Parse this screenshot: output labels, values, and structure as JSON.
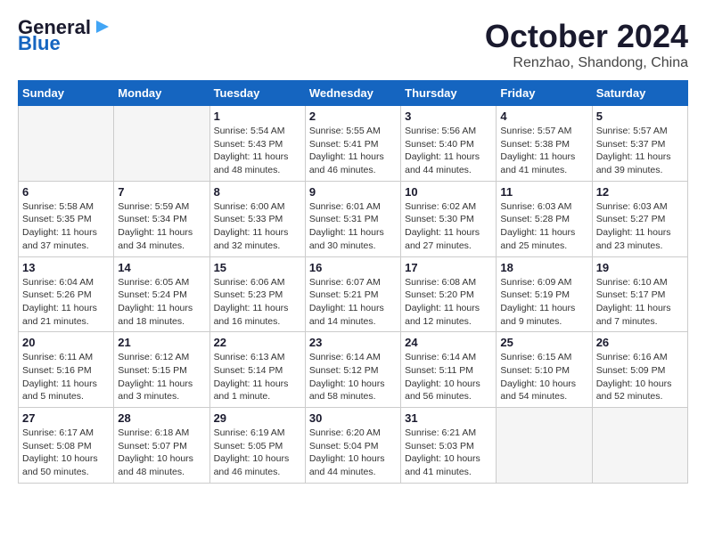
{
  "header": {
    "logo_line1": "General",
    "logo_line2": "Blue",
    "month": "October 2024",
    "location": "Renzhao, Shandong, China"
  },
  "days_of_week": [
    "Sunday",
    "Monday",
    "Tuesday",
    "Wednesday",
    "Thursday",
    "Friday",
    "Saturday"
  ],
  "weeks": [
    [
      {
        "day": "",
        "info": ""
      },
      {
        "day": "",
        "info": ""
      },
      {
        "day": "1",
        "info": "Sunrise: 5:54 AM\nSunset: 5:43 PM\nDaylight: 11 hours and 48 minutes."
      },
      {
        "day": "2",
        "info": "Sunrise: 5:55 AM\nSunset: 5:41 PM\nDaylight: 11 hours and 46 minutes."
      },
      {
        "day": "3",
        "info": "Sunrise: 5:56 AM\nSunset: 5:40 PM\nDaylight: 11 hours and 44 minutes."
      },
      {
        "day": "4",
        "info": "Sunrise: 5:57 AM\nSunset: 5:38 PM\nDaylight: 11 hours and 41 minutes."
      },
      {
        "day": "5",
        "info": "Sunrise: 5:57 AM\nSunset: 5:37 PM\nDaylight: 11 hours and 39 minutes."
      }
    ],
    [
      {
        "day": "6",
        "info": "Sunrise: 5:58 AM\nSunset: 5:35 PM\nDaylight: 11 hours and 37 minutes."
      },
      {
        "day": "7",
        "info": "Sunrise: 5:59 AM\nSunset: 5:34 PM\nDaylight: 11 hours and 34 minutes."
      },
      {
        "day": "8",
        "info": "Sunrise: 6:00 AM\nSunset: 5:33 PM\nDaylight: 11 hours and 32 minutes."
      },
      {
        "day": "9",
        "info": "Sunrise: 6:01 AM\nSunset: 5:31 PM\nDaylight: 11 hours and 30 minutes."
      },
      {
        "day": "10",
        "info": "Sunrise: 6:02 AM\nSunset: 5:30 PM\nDaylight: 11 hours and 27 minutes."
      },
      {
        "day": "11",
        "info": "Sunrise: 6:03 AM\nSunset: 5:28 PM\nDaylight: 11 hours and 25 minutes."
      },
      {
        "day": "12",
        "info": "Sunrise: 6:03 AM\nSunset: 5:27 PM\nDaylight: 11 hours and 23 minutes."
      }
    ],
    [
      {
        "day": "13",
        "info": "Sunrise: 6:04 AM\nSunset: 5:26 PM\nDaylight: 11 hours and 21 minutes."
      },
      {
        "day": "14",
        "info": "Sunrise: 6:05 AM\nSunset: 5:24 PM\nDaylight: 11 hours and 18 minutes."
      },
      {
        "day": "15",
        "info": "Sunrise: 6:06 AM\nSunset: 5:23 PM\nDaylight: 11 hours and 16 minutes."
      },
      {
        "day": "16",
        "info": "Sunrise: 6:07 AM\nSunset: 5:21 PM\nDaylight: 11 hours and 14 minutes."
      },
      {
        "day": "17",
        "info": "Sunrise: 6:08 AM\nSunset: 5:20 PM\nDaylight: 11 hours and 12 minutes."
      },
      {
        "day": "18",
        "info": "Sunrise: 6:09 AM\nSunset: 5:19 PM\nDaylight: 11 hours and 9 minutes."
      },
      {
        "day": "19",
        "info": "Sunrise: 6:10 AM\nSunset: 5:17 PM\nDaylight: 11 hours and 7 minutes."
      }
    ],
    [
      {
        "day": "20",
        "info": "Sunrise: 6:11 AM\nSunset: 5:16 PM\nDaylight: 11 hours and 5 minutes."
      },
      {
        "day": "21",
        "info": "Sunrise: 6:12 AM\nSunset: 5:15 PM\nDaylight: 11 hours and 3 minutes."
      },
      {
        "day": "22",
        "info": "Sunrise: 6:13 AM\nSunset: 5:14 PM\nDaylight: 11 hours and 1 minute."
      },
      {
        "day": "23",
        "info": "Sunrise: 6:14 AM\nSunset: 5:12 PM\nDaylight: 10 hours and 58 minutes."
      },
      {
        "day": "24",
        "info": "Sunrise: 6:14 AM\nSunset: 5:11 PM\nDaylight: 10 hours and 56 minutes."
      },
      {
        "day": "25",
        "info": "Sunrise: 6:15 AM\nSunset: 5:10 PM\nDaylight: 10 hours and 54 minutes."
      },
      {
        "day": "26",
        "info": "Sunrise: 6:16 AM\nSunset: 5:09 PM\nDaylight: 10 hours and 52 minutes."
      }
    ],
    [
      {
        "day": "27",
        "info": "Sunrise: 6:17 AM\nSunset: 5:08 PM\nDaylight: 10 hours and 50 minutes."
      },
      {
        "day": "28",
        "info": "Sunrise: 6:18 AM\nSunset: 5:07 PM\nDaylight: 10 hours and 48 minutes."
      },
      {
        "day": "29",
        "info": "Sunrise: 6:19 AM\nSunset: 5:05 PM\nDaylight: 10 hours and 46 minutes."
      },
      {
        "day": "30",
        "info": "Sunrise: 6:20 AM\nSunset: 5:04 PM\nDaylight: 10 hours and 44 minutes."
      },
      {
        "day": "31",
        "info": "Sunrise: 6:21 AM\nSunset: 5:03 PM\nDaylight: 10 hours and 41 minutes."
      },
      {
        "day": "",
        "info": ""
      },
      {
        "day": "",
        "info": ""
      }
    ]
  ]
}
